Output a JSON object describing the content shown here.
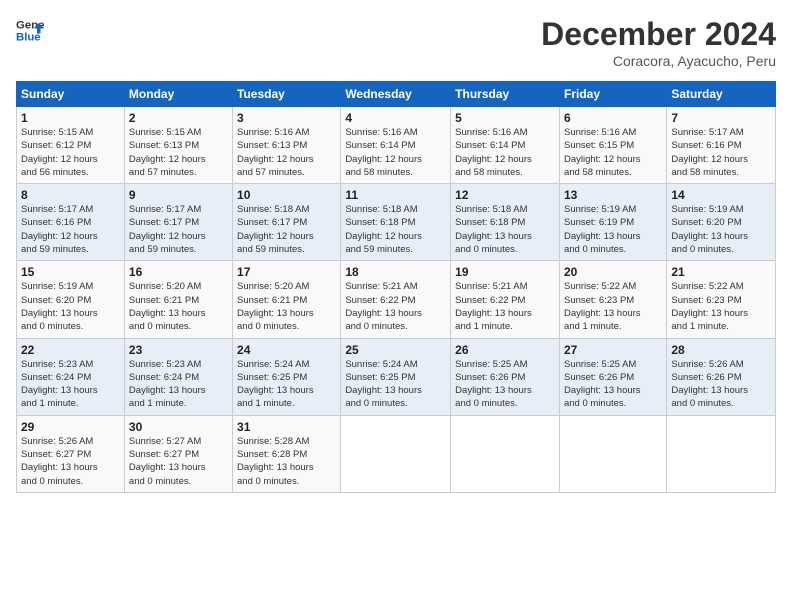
{
  "header": {
    "logo_line1": "General",
    "logo_line2": "Blue",
    "month_title": "December 2024",
    "location": "Coracora, Ayacucho, Peru"
  },
  "weekdays": [
    "Sunday",
    "Monday",
    "Tuesday",
    "Wednesday",
    "Thursday",
    "Friday",
    "Saturday"
  ],
  "weeks": [
    [
      {
        "day": "1",
        "info": "Sunrise: 5:15 AM\nSunset: 6:12 PM\nDaylight: 12 hours\nand 56 minutes."
      },
      {
        "day": "2",
        "info": "Sunrise: 5:15 AM\nSunset: 6:13 PM\nDaylight: 12 hours\nand 57 minutes."
      },
      {
        "day": "3",
        "info": "Sunrise: 5:16 AM\nSunset: 6:13 PM\nDaylight: 12 hours\nand 57 minutes."
      },
      {
        "day": "4",
        "info": "Sunrise: 5:16 AM\nSunset: 6:14 PM\nDaylight: 12 hours\nand 58 minutes."
      },
      {
        "day": "5",
        "info": "Sunrise: 5:16 AM\nSunset: 6:14 PM\nDaylight: 12 hours\nand 58 minutes."
      },
      {
        "day": "6",
        "info": "Sunrise: 5:16 AM\nSunset: 6:15 PM\nDaylight: 12 hours\nand 58 minutes."
      },
      {
        "day": "7",
        "info": "Sunrise: 5:17 AM\nSunset: 6:16 PM\nDaylight: 12 hours\nand 58 minutes."
      }
    ],
    [
      {
        "day": "8",
        "info": "Sunrise: 5:17 AM\nSunset: 6:16 PM\nDaylight: 12 hours\nand 59 minutes."
      },
      {
        "day": "9",
        "info": "Sunrise: 5:17 AM\nSunset: 6:17 PM\nDaylight: 12 hours\nand 59 minutes."
      },
      {
        "day": "10",
        "info": "Sunrise: 5:18 AM\nSunset: 6:17 PM\nDaylight: 12 hours\nand 59 minutes."
      },
      {
        "day": "11",
        "info": "Sunrise: 5:18 AM\nSunset: 6:18 PM\nDaylight: 12 hours\nand 59 minutes."
      },
      {
        "day": "12",
        "info": "Sunrise: 5:18 AM\nSunset: 6:18 PM\nDaylight: 13 hours\nand 0 minutes."
      },
      {
        "day": "13",
        "info": "Sunrise: 5:19 AM\nSunset: 6:19 PM\nDaylight: 13 hours\nand 0 minutes."
      },
      {
        "day": "14",
        "info": "Sunrise: 5:19 AM\nSunset: 6:20 PM\nDaylight: 13 hours\nand 0 minutes."
      }
    ],
    [
      {
        "day": "15",
        "info": "Sunrise: 5:19 AM\nSunset: 6:20 PM\nDaylight: 13 hours\nand 0 minutes."
      },
      {
        "day": "16",
        "info": "Sunrise: 5:20 AM\nSunset: 6:21 PM\nDaylight: 13 hours\nand 0 minutes."
      },
      {
        "day": "17",
        "info": "Sunrise: 5:20 AM\nSunset: 6:21 PM\nDaylight: 13 hours\nand 0 minutes."
      },
      {
        "day": "18",
        "info": "Sunrise: 5:21 AM\nSunset: 6:22 PM\nDaylight: 13 hours\nand 0 minutes."
      },
      {
        "day": "19",
        "info": "Sunrise: 5:21 AM\nSunset: 6:22 PM\nDaylight: 13 hours\nand 1 minute."
      },
      {
        "day": "20",
        "info": "Sunrise: 5:22 AM\nSunset: 6:23 PM\nDaylight: 13 hours\nand 1 minute."
      },
      {
        "day": "21",
        "info": "Sunrise: 5:22 AM\nSunset: 6:23 PM\nDaylight: 13 hours\nand 1 minute."
      }
    ],
    [
      {
        "day": "22",
        "info": "Sunrise: 5:23 AM\nSunset: 6:24 PM\nDaylight: 13 hours\nand 1 minute."
      },
      {
        "day": "23",
        "info": "Sunrise: 5:23 AM\nSunset: 6:24 PM\nDaylight: 13 hours\nand 1 minute."
      },
      {
        "day": "24",
        "info": "Sunrise: 5:24 AM\nSunset: 6:25 PM\nDaylight: 13 hours\nand 1 minute."
      },
      {
        "day": "25",
        "info": "Sunrise: 5:24 AM\nSunset: 6:25 PM\nDaylight: 13 hours\nand 0 minutes."
      },
      {
        "day": "26",
        "info": "Sunrise: 5:25 AM\nSunset: 6:26 PM\nDaylight: 13 hours\nand 0 minutes."
      },
      {
        "day": "27",
        "info": "Sunrise: 5:25 AM\nSunset: 6:26 PM\nDaylight: 13 hours\nand 0 minutes."
      },
      {
        "day": "28",
        "info": "Sunrise: 5:26 AM\nSunset: 6:26 PM\nDaylight: 13 hours\nand 0 minutes."
      }
    ],
    [
      {
        "day": "29",
        "info": "Sunrise: 5:26 AM\nSunset: 6:27 PM\nDaylight: 13 hours\nand 0 minutes."
      },
      {
        "day": "30",
        "info": "Sunrise: 5:27 AM\nSunset: 6:27 PM\nDaylight: 13 hours\nand 0 minutes."
      },
      {
        "day": "31",
        "info": "Sunrise: 5:28 AM\nSunset: 6:28 PM\nDaylight: 13 hours\nand 0 minutes."
      },
      {
        "day": "",
        "info": ""
      },
      {
        "day": "",
        "info": ""
      },
      {
        "day": "",
        "info": ""
      },
      {
        "day": "",
        "info": ""
      }
    ]
  ]
}
